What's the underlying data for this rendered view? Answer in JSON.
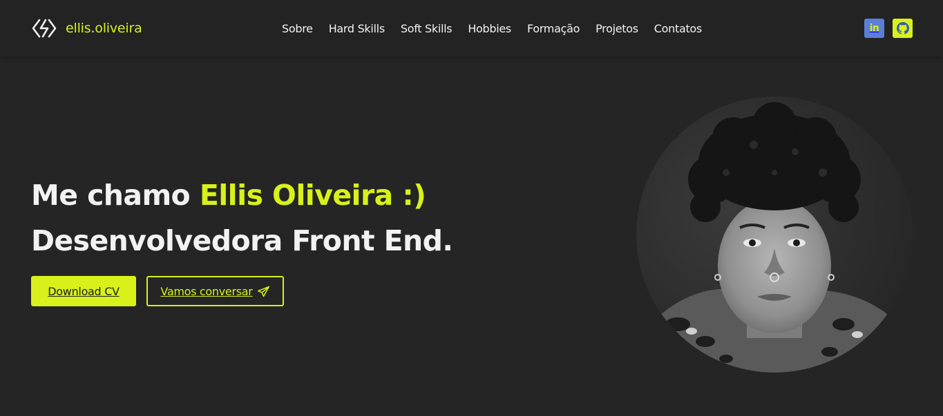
{
  "brand": {
    "logo_icon": "code-brackets-logo-icon",
    "name_first": "ellis",
    "name_dot": ".",
    "name_last": "oliveira"
  },
  "nav": {
    "items": [
      {
        "label": "Sobre"
      },
      {
        "label": "Hard Skills"
      },
      {
        "label": "Soft Skills"
      },
      {
        "label": "Hobbies"
      },
      {
        "label": "Formação"
      },
      {
        "label": "Projetos"
      },
      {
        "label": "Contatos"
      }
    ]
  },
  "social": {
    "linkedin": {
      "icon": "linkedin-icon",
      "glyph": "in",
      "color": "#5b7fd6"
    },
    "github": {
      "icon": "github-icon",
      "color": "#d8f11a"
    }
  },
  "hero": {
    "greeting": "Me chamo ",
    "name": "Ellis Oliveira :)",
    "role": "Desenvolvedora Front End.",
    "download_label": "Download CV",
    "contact_label": "Vamos conversar",
    "contact_icon": "paper-plane-icon",
    "photo": "profile-photo"
  },
  "colors": {
    "accent": "#d8f11a",
    "background": "#252525",
    "navbar": "#232323",
    "text": "#f2f2f2"
  }
}
